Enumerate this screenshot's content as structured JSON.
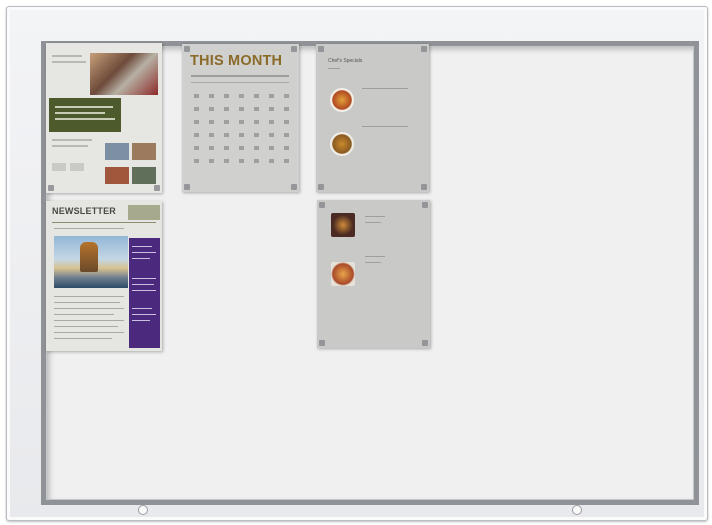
{
  "board": {
    "posters": {
      "brochure": {},
      "calendar": {
        "title": "THIS MONTH"
      },
      "menu_top": {
        "title": "Chef's Specials"
      },
      "menu_bottom": {},
      "newsletter": {
        "title": "NEWSLETTER"
      }
    }
  },
  "colors": {
    "frame": "#e8e9ec",
    "board_border": "#8f9296",
    "board_surface": "#f0f0f1",
    "calendar_title": "#8a6b2a",
    "newsletter_sidebar": "#4b2a7d",
    "brochure_bar": "#4c5a2c"
  }
}
